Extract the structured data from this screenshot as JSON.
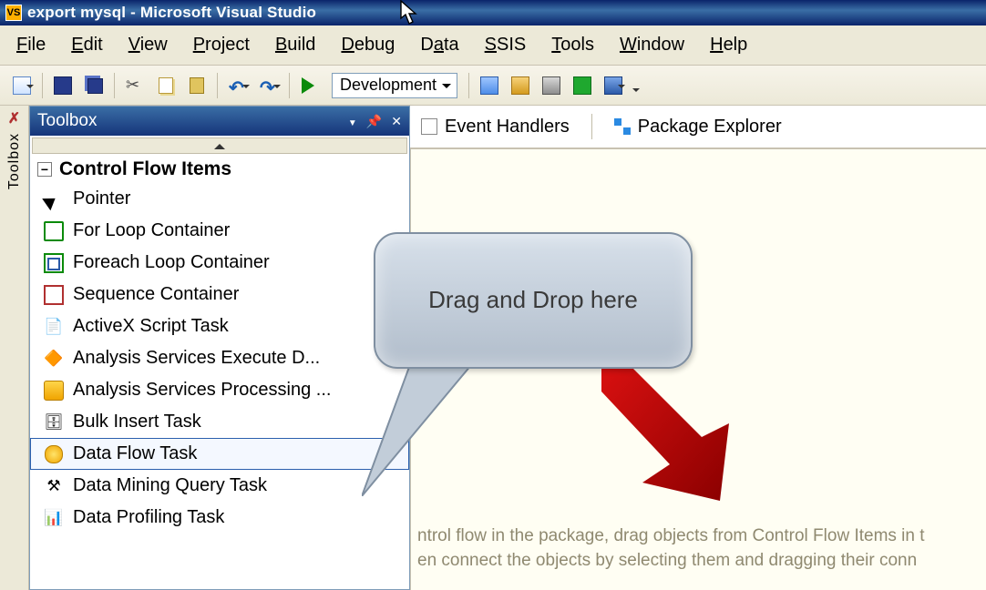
{
  "titlebar": {
    "title": "export mysql - Microsoft Visual Studio"
  },
  "menu": {
    "file": "File",
    "edit": "Edit",
    "view": "View",
    "project": "Project",
    "build": "Build",
    "debug": "Debug",
    "data": "Data",
    "ssis": "SSIS",
    "tools": "Tools",
    "window": "Window",
    "help": "Help"
  },
  "toolbar": {
    "config": "Development"
  },
  "toolbox": {
    "title": "Toolbox",
    "group": "Control Flow Items",
    "items": [
      "Pointer",
      "For Loop Container",
      "Foreach Loop Container",
      "Sequence Container",
      "ActiveX Script Task",
      "Analysis Services Execute D...",
      "Analysis Services Processing ...",
      "Bulk Insert Task",
      "Data Flow Task",
      "Data Mining Query Task",
      "Data Profiling Task"
    ],
    "selected_index": 8
  },
  "vtab": {
    "label": "Toolbox"
  },
  "tabs": {
    "eh": "Event Handlers",
    "pe": "Package Explorer"
  },
  "callout": {
    "text": "Drag and Drop here"
  },
  "hint": {
    "l1": "ntrol flow in the package, drag objects from Control Flow Items in t",
    "l2": "en connect the objects by selecting them and dragging their conn"
  }
}
